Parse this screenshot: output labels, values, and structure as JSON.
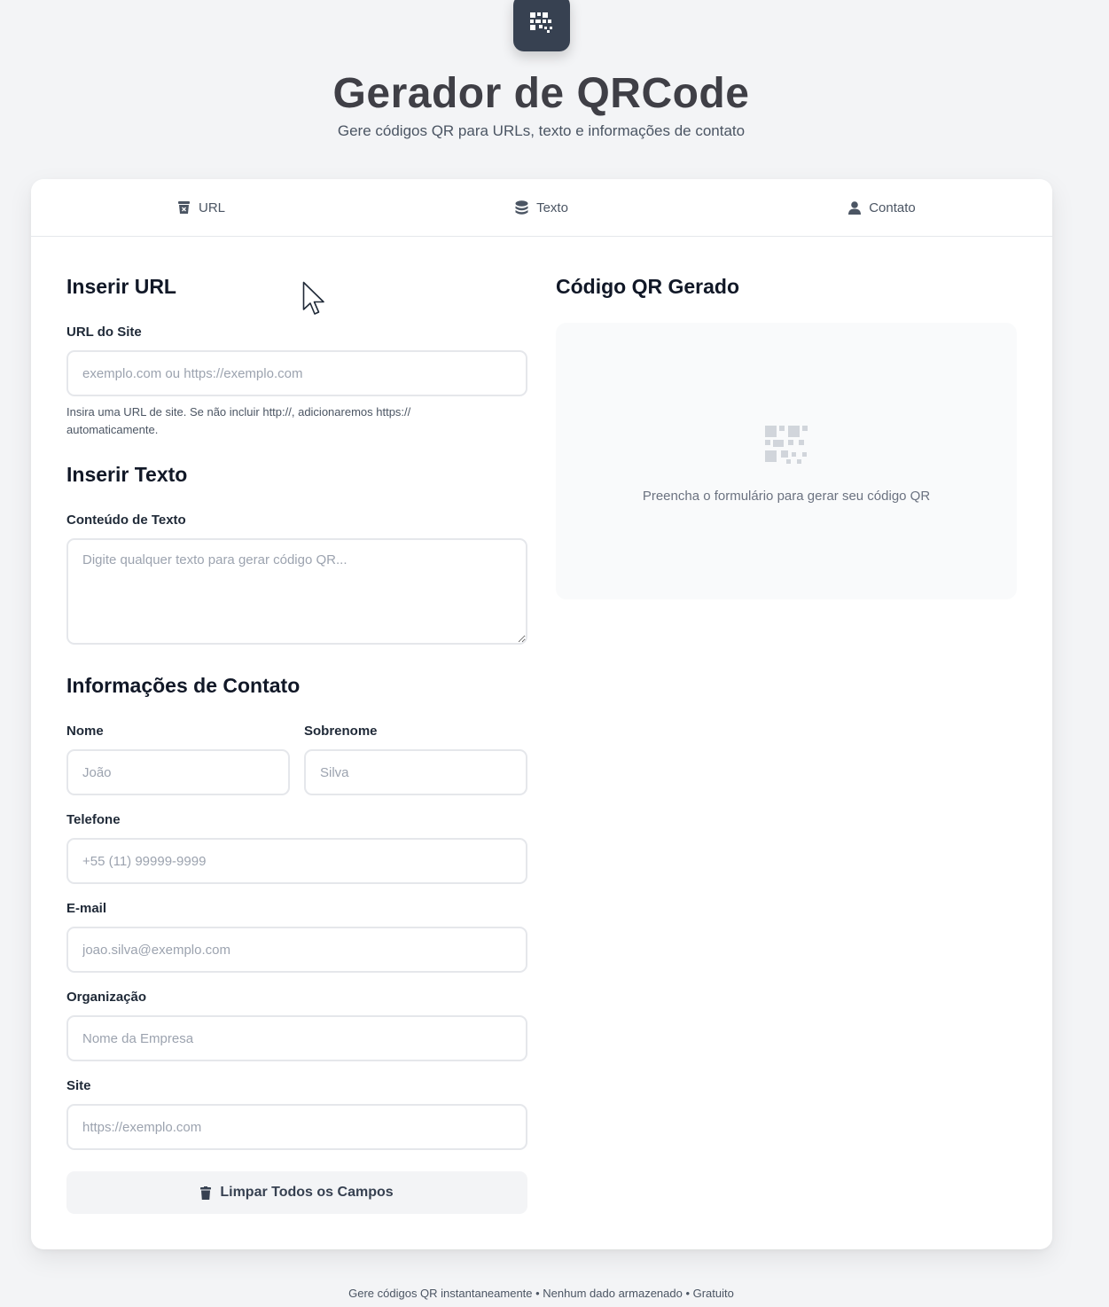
{
  "header": {
    "title": "Gerador de QRCode",
    "subtitle": "Gere códigos QR para URLs, texto e informações de contato"
  },
  "tabs": [
    {
      "label": "URL",
      "icon": "trash-can-icon"
    },
    {
      "label": "Texto",
      "icon": "layers-icon"
    },
    {
      "label": "Contato",
      "icon": "user-icon"
    }
  ],
  "url_section": {
    "title": "Inserir URL",
    "label": "URL do Site",
    "placeholder": "exemplo.com ou https://exemplo.com",
    "value": "",
    "help": "Insira uma URL de site. Se não incluir http://, adicionaremos https:// automaticamente."
  },
  "text_section": {
    "title": "Inserir Texto",
    "label": "Conteúdo de Texto",
    "placeholder": "Digite qualquer texto para gerar código QR...",
    "value": ""
  },
  "contact_section": {
    "title": "Informações de Contato",
    "first_name": {
      "label": "Nome",
      "placeholder": "João",
      "value": ""
    },
    "last_name": {
      "label": "Sobrenome",
      "placeholder": "Silva",
      "value": ""
    },
    "phone": {
      "label": "Telefone",
      "placeholder": "+55 (11) 99999-9999",
      "value": ""
    },
    "email": {
      "label": "E-mail",
      "placeholder": "joao.silva@exemplo.com",
      "value": ""
    },
    "organization": {
      "label": "Organização",
      "placeholder": "Nome da Empresa",
      "value": ""
    },
    "website": {
      "label": "Site",
      "placeholder": "https://exemplo.com",
      "value": ""
    }
  },
  "clear_button": {
    "label": "Limpar Todos os Campos",
    "icon": "trash-icon"
  },
  "preview": {
    "title": "Código QR Gerado",
    "placeholder_text": "Preencha o formulário para gerar seu código QR",
    "icon": "qrcode-icon"
  },
  "footer": {
    "text": "Gere códigos QR instantaneamente • Nenhum dado armazenado • Gratuito"
  },
  "colors": {
    "background": "#f3f4f6",
    "card": "#ffffff",
    "logo_bg": "#374151",
    "title": "#3f3f46",
    "border": "#e5e7eb",
    "placeholder": "#9ca3af"
  }
}
